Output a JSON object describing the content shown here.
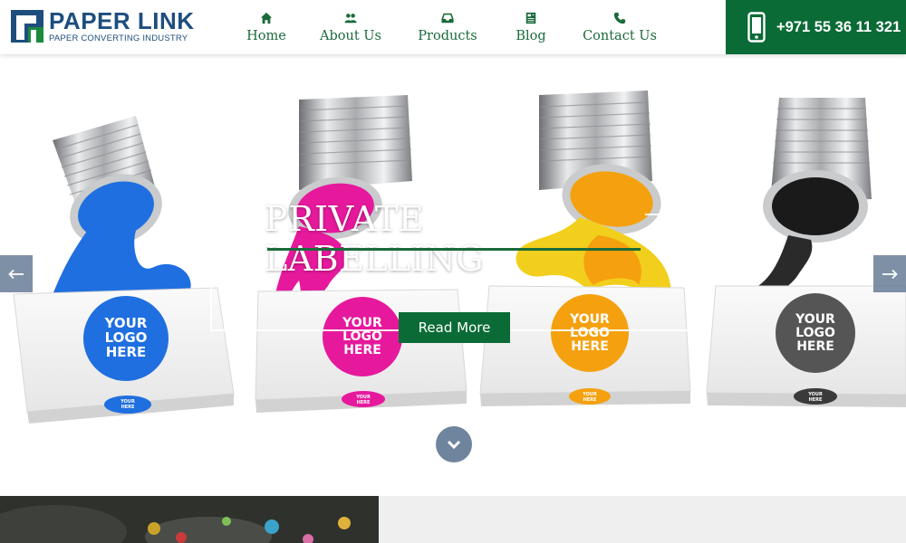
{
  "brand": {
    "name": "PAPER LINK",
    "tagline": "PAPER CONVERTING INDUSTRY",
    "colors": {
      "primary_green": "#0b6b36",
      "logo_blue": "#1d4e7e",
      "logo_green": "#1b6b3a"
    }
  },
  "nav": {
    "items": [
      {
        "label": "Home",
        "icon": "home-icon"
      },
      {
        "label": "About Us",
        "icon": "users-icon"
      },
      {
        "label": "Products",
        "icon": "inbox-icon"
      },
      {
        "label": "Blog",
        "icon": "newspaper-icon"
      },
      {
        "label": "Contact Us",
        "icon": "phone-icon"
      }
    ]
  },
  "contact": {
    "phone": "+971 55 36 11 321",
    "icon": "mobile-phone-icon"
  },
  "hero": {
    "title": "PRIVATE LABELLING",
    "button_label": "Read More",
    "prev_icon": "arrow-left-icon",
    "next_icon": "arrow-right-icon",
    "scroll_icon": "chevron-down-icon",
    "boxes": [
      {
        "logo_lines": [
          "YOUR",
          "LOGO",
          "HERE"
        ],
        "color": "#1f6fe0"
      },
      {
        "logo_lines": [
          "YOUR",
          "LOGO",
          "HERE"
        ],
        "color": "#e6199d"
      },
      {
        "logo_lines": [
          "YOUR",
          "LOGO",
          "HERE"
        ],
        "color": "#f5a10f"
      },
      {
        "logo_lines": [
          "YOUR",
          "LOGO",
          "HERE"
        ],
        "color": "#555555"
      }
    ]
  }
}
